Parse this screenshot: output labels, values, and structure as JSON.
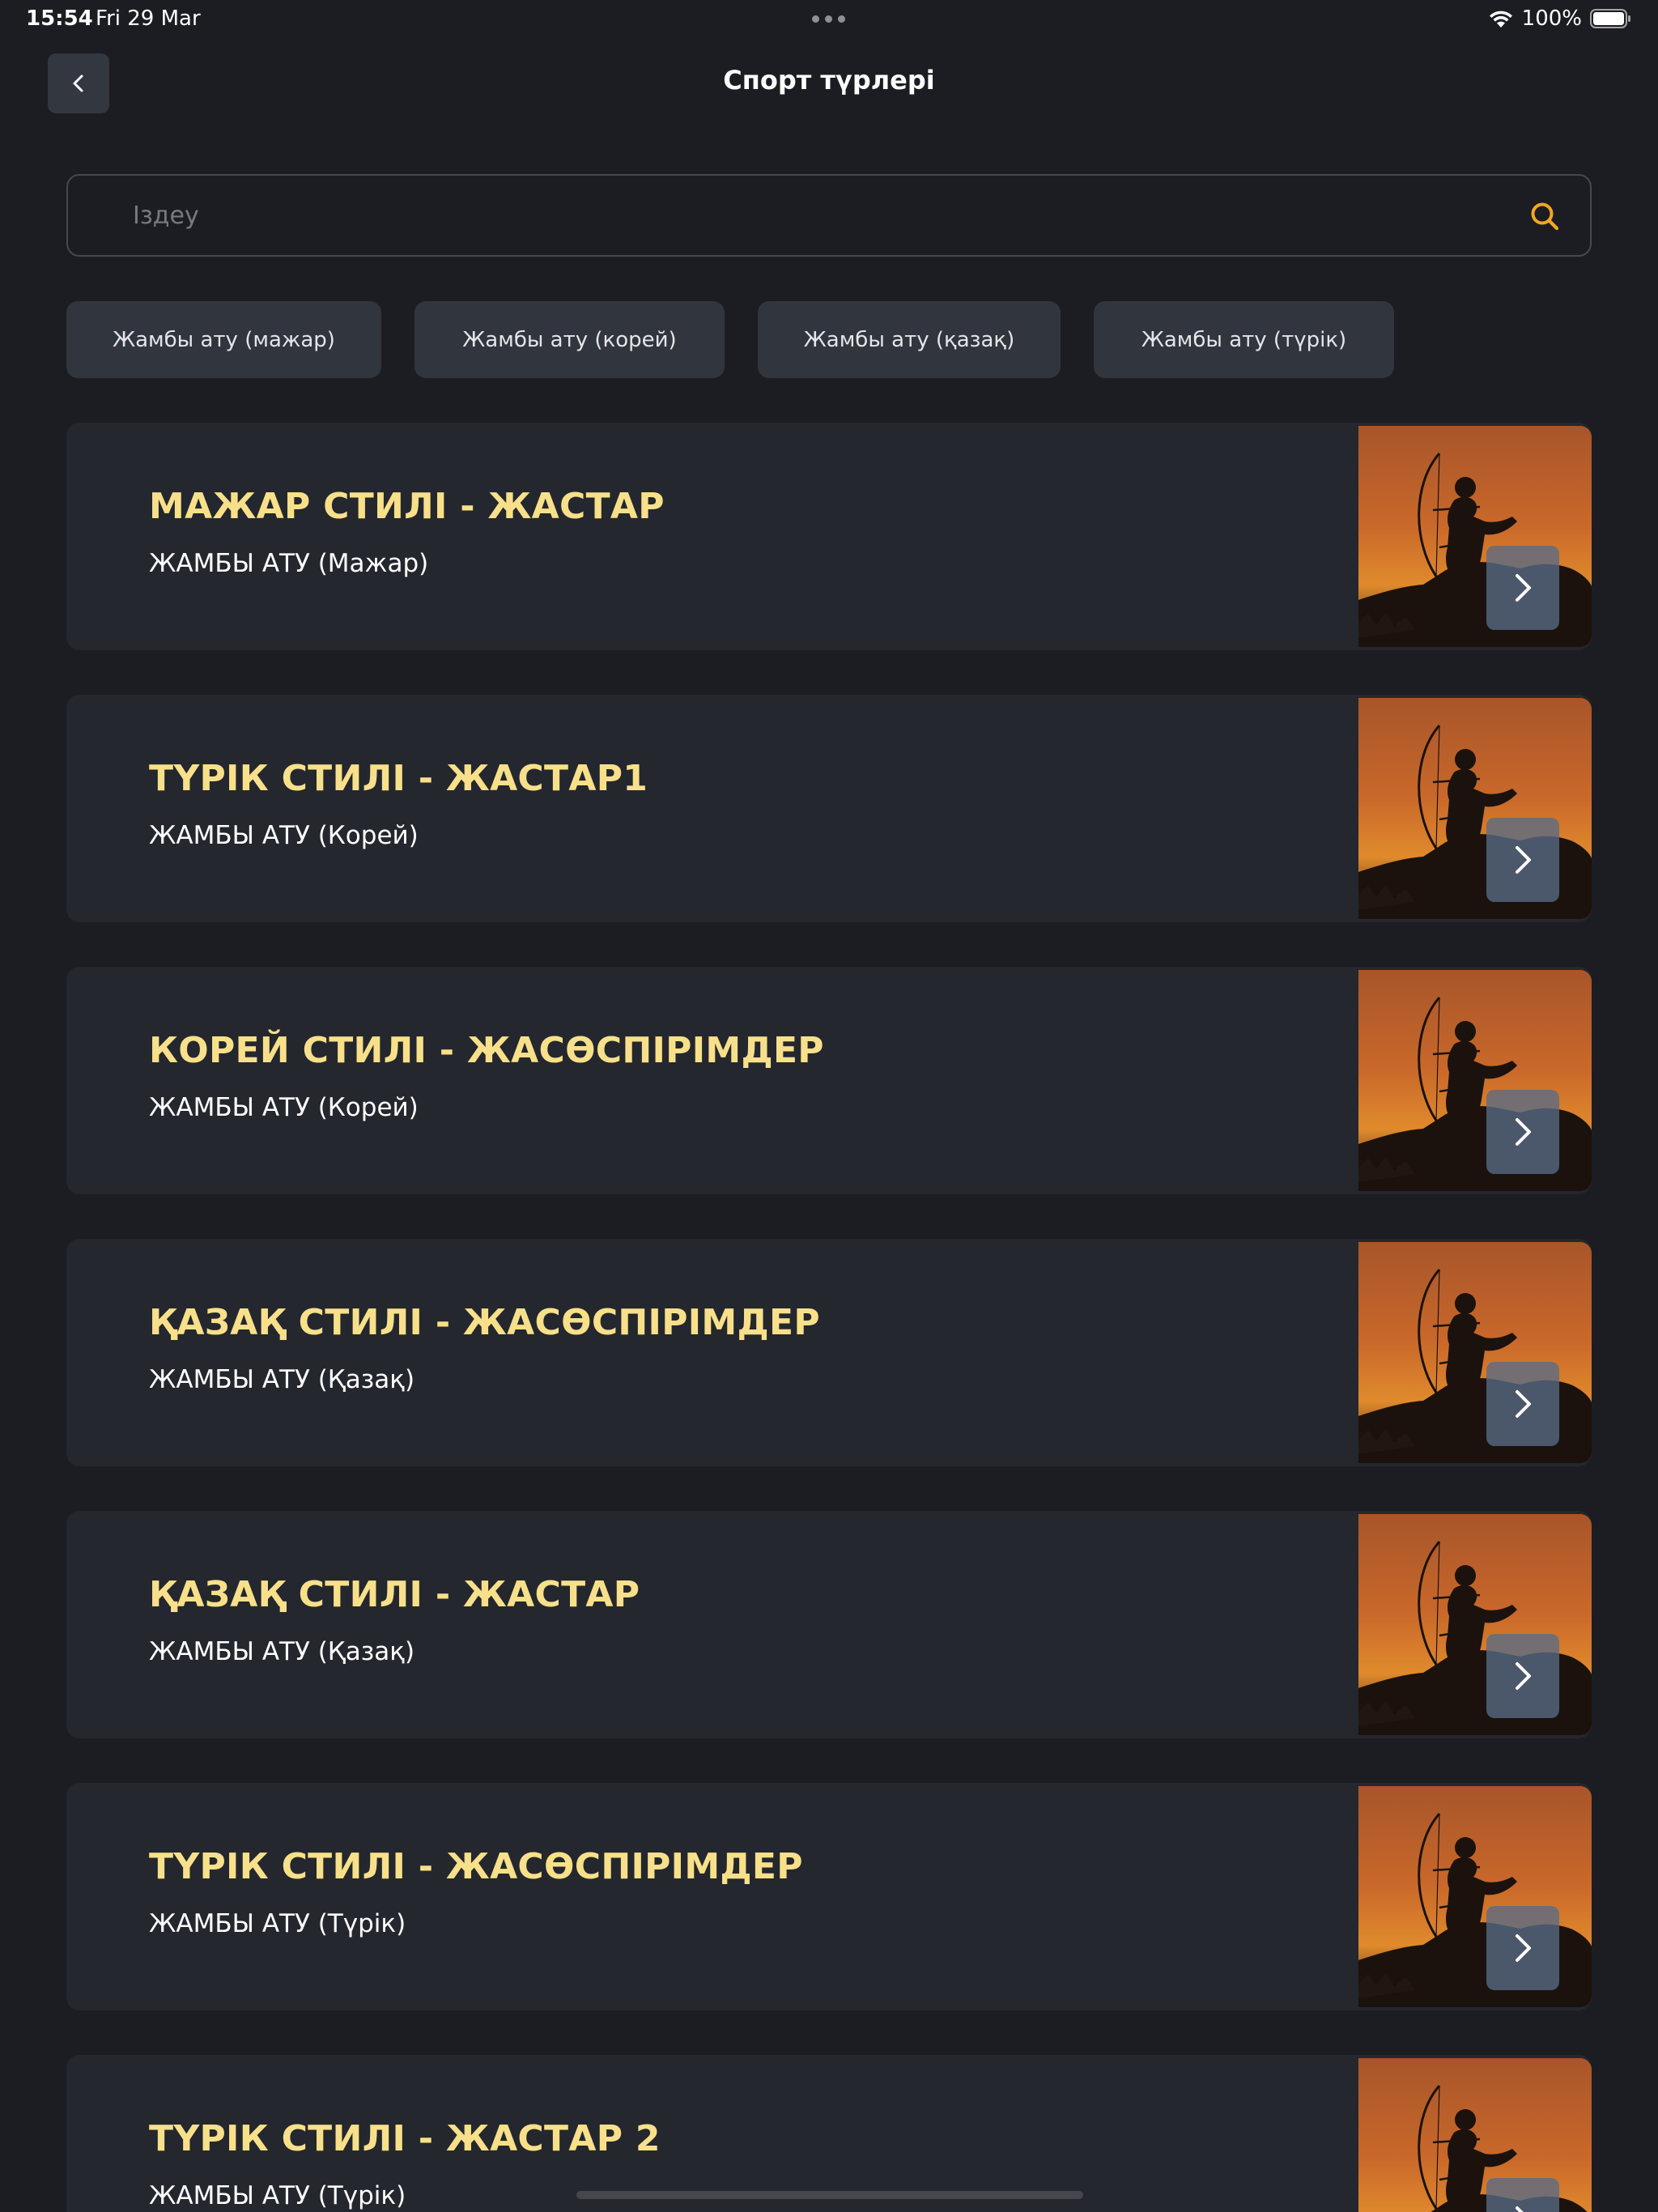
{
  "status_bar": {
    "time": "15:54",
    "date": "Fri 29 Mar",
    "battery": "100%"
  },
  "header": {
    "title": "Спорт түрлері"
  },
  "search": {
    "placeholder": "Іздеу",
    "value": ""
  },
  "filters": [
    {
      "label": "Жамбы ату (мажар)"
    },
    {
      "label": "Жамбы ату (корей)"
    },
    {
      "label": "Жамбы ату (қазақ)"
    },
    {
      "label": "Жамбы ату (түрік)"
    }
  ],
  "cards": [
    {
      "title": "МАЖАР СТИЛІ - ЖАСТАР",
      "subtitle": "ЖАМБЫ АТУ (Мажар)"
    },
    {
      "title": "ТҮРІК СТИЛІ - ЖАСТАР1",
      "subtitle": "ЖАМБЫ АТУ (Корей)"
    },
    {
      "title": "КОРЕЙ СТИЛІ - ЖАСӨСПІРІМДЕР",
      "subtitle": "ЖАМБЫ АТУ (Корей)"
    },
    {
      "title": "ҚАЗАҚ СТИЛІ - ЖАСӨСПІРІМДЕР",
      "subtitle": "ЖАМБЫ АТУ (Қазақ)"
    },
    {
      "title": "ҚАЗАҚ СТИЛІ - ЖАСТАР",
      "subtitle": "ЖАМБЫ АТУ (Қазақ)"
    },
    {
      "title": "ТҮРІК СТИЛІ - ЖАСӨСПІРІМДЕР",
      "subtitle": "ЖАМБЫ АТУ (Түрік)"
    },
    {
      "title": "ТҮРІК СТИЛІ - ЖАСТАР 2",
      "subtitle": "ЖАМБЫ АТУ (Түрік)"
    }
  ],
  "icons": {
    "back": "chevron-left-icon",
    "search": "search-icon",
    "card_action": "chevron-right-icon",
    "thumbnail": "horse-archer-image"
  },
  "colors": {
    "background": "#1b1d22",
    "card": "#24272e",
    "chip": "#31353d",
    "title_accent": "#f8e08a",
    "search_accent": "#f5a623"
  }
}
